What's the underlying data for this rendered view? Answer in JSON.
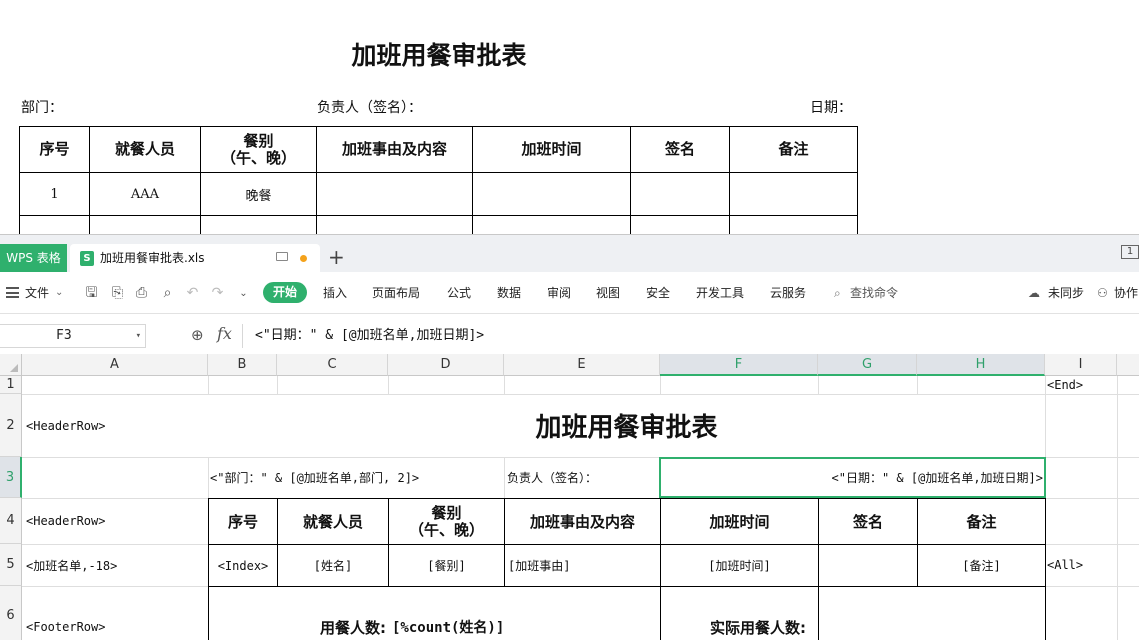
{
  "preview": {
    "title": "加班用餐审批表",
    "dept_label": "部门：",
    "owner_label": "负责人（签名）：",
    "date_label": "日期：",
    "headers": [
      "序号",
      "就餐人员",
      "餐别\n（午、晚）",
      "加班事由及内容",
      "加班时间",
      "签名",
      "备注"
    ],
    "row1": [
      "1",
      "AAA",
      "晚餐",
      "",
      "",
      "",
      ""
    ]
  },
  "app": {
    "wps_tab": "WPS 表格",
    "doc_icon": "S",
    "doc_name": "加班用餐审批表.xls",
    "new_tab": "+",
    "win_btn": "1"
  },
  "menu": {
    "file": "文件",
    "start": "开始",
    "items": [
      "插入",
      "页面布局",
      "公式",
      "数据",
      "审阅",
      "视图",
      "安全",
      "开发工具",
      "云服务"
    ],
    "search": "查找命令",
    "sync": "未同步",
    "collab": "协作"
  },
  "formula_bar": {
    "cell_ref": "F3",
    "fx": "fx",
    "formula": "<\"日期：\" & [@加班名单,加班日期]>"
  },
  "grid": {
    "columns": [
      "A",
      "B",
      "C",
      "D",
      "E",
      "F",
      "G",
      "H",
      "I"
    ],
    "rows": [
      "1",
      "2",
      "3",
      "4",
      "5",
      "6"
    ],
    "cells": {
      "I1": "<End>",
      "A2": "<HeaderRow>",
      "title": "加班用餐审批表",
      "B3": "<\"部门：\" & [@加班名单,部门, 2]>",
      "E3": "负责人（签名）：",
      "F3": "<\"日期：\" & [@加班名单,加班日期]>",
      "A4": "<HeaderRow>",
      "B4": "序号",
      "C4": "就餐人员",
      "D4": "餐别\n（午、晚）",
      "E4": "加班事由及内容",
      "F4": "加班时间",
      "G4": "签名",
      "H4": "备注",
      "A5": "<加班名单,-18>",
      "B5": "<Index>",
      "C5": "[姓名]",
      "D5": "[餐别]",
      "E5": "[加班事由]",
      "F5": "[加班时间]",
      "H5": "[备注]",
      "I5": "<All>",
      "A6": "<FooterRow>",
      "C6": "用餐人数:",
      "D6": "[%count(姓名)]",
      "F6": "实际用餐人数:"
    }
  },
  "colors": {
    "accent": "#2fb06d",
    "tab_bg": "#eef0f3"
  }
}
